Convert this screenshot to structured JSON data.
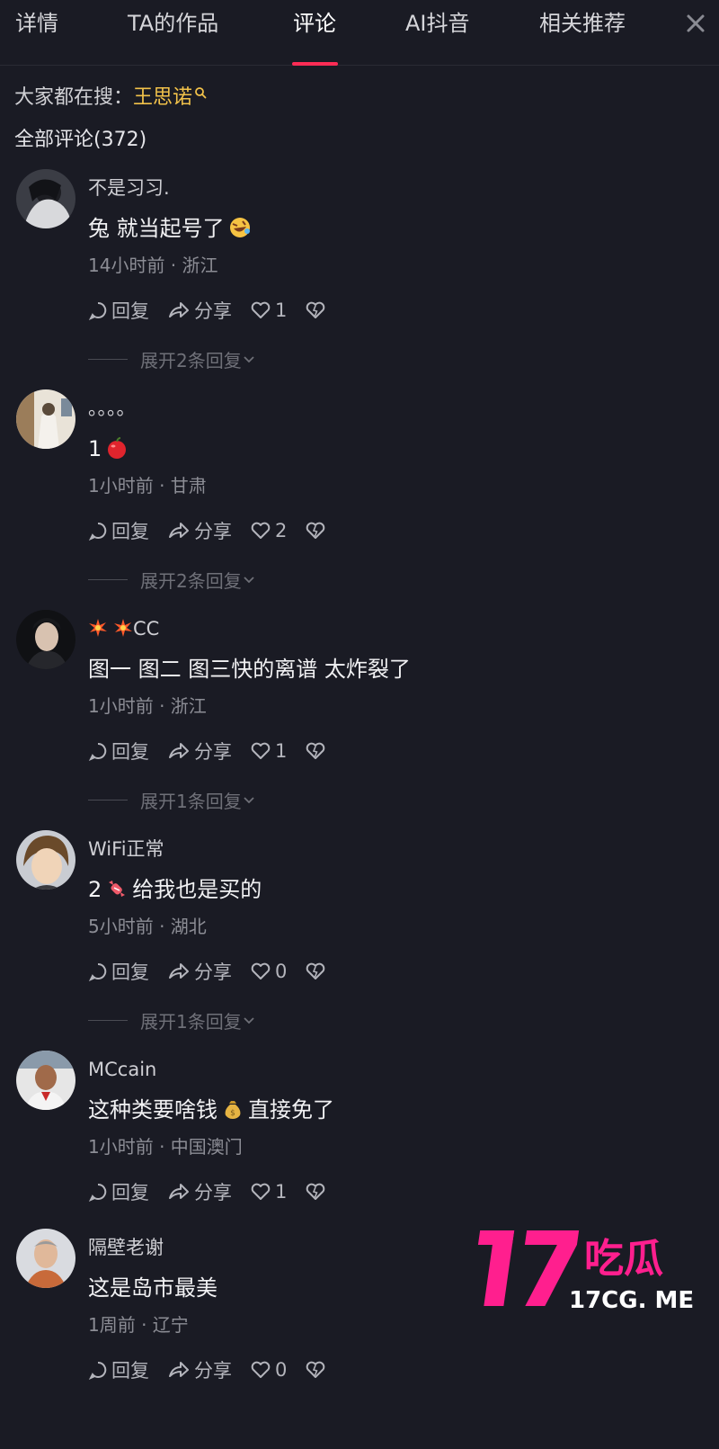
{
  "tabs": [
    {
      "label": "详情"
    },
    {
      "label": "TA的作品"
    },
    {
      "label": "评论"
    },
    {
      "label": "AI抖音"
    },
    {
      "label": "相关推荐"
    }
  ],
  "active_tab": "评论",
  "close_icon": "close-icon",
  "search": {
    "prefix": "大家都在搜：",
    "keyword": "王思诺"
  },
  "comments_count_label": "全部评论(372)",
  "action_labels": {
    "reply": "回复",
    "share": "分享"
  },
  "comments": [
    {
      "username": "不是习习.",
      "text_before": "兔 就当起号了",
      "emoji": "rofl-emoji",
      "text_after": "",
      "meta": "14小时前 · 浙江",
      "likes": "1",
      "expand": "展开2条回复"
    },
    {
      "username": "。。。。",
      "text_before": "1",
      "emoji": "apple-emoji",
      "text_after": "",
      "meta": "1小时前 · 甘肃",
      "likes": "2",
      "expand": "展开2条回复"
    },
    {
      "username_icon": "firework-icon",
      "username": "CC",
      "text_before": "图一 图二 图三快的离谱 太炸裂了",
      "emoji": "",
      "text_after": "",
      "meta": "1小时前 · 浙江",
      "likes": "1",
      "expand": "展开1条回复"
    },
    {
      "username": "WiFi正常",
      "text_before": "2",
      "emoji": "candy-emoji",
      "text_after": "给我也是买的",
      "meta": "5小时前 · 湖北",
      "likes": "0",
      "expand": "展开1条回复"
    },
    {
      "username": "MCcain",
      "text_before": "这种类要啥钱",
      "emoji": "money-bag-emoji",
      "text_after": "直接免了",
      "meta": "1小时前 · 中国澳门",
      "likes": "1",
      "expand": ""
    },
    {
      "username": "隔壁老谢",
      "text_before": "这是岛市最美",
      "emoji": "",
      "text_after": "",
      "meta": "1周前 · 辽宁",
      "likes": "0",
      "expand": ""
    }
  ],
  "watermark": {
    "logo_text": "17吃瓜",
    "domain": "17CG. ME",
    "color": "#ff1f8e"
  },
  "colors": {
    "accent": "#fe2c55",
    "keyword": "#f2c24a",
    "background": "#1a1b24"
  }
}
